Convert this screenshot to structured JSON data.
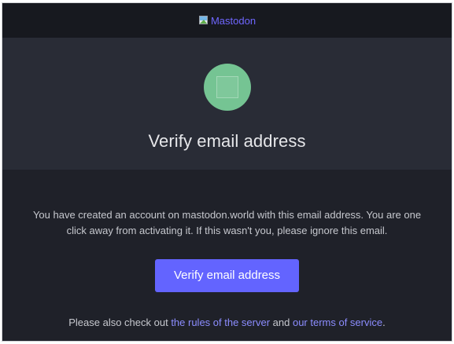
{
  "header": {
    "logo_alt": "Mastodon",
    "logo_icon": "broken-image-icon"
  },
  "hero": {
    "badge_icon": "broken-image-icon",
    "badge_color": "#75c493",
    "title": "Verify email address"
  },
  "content": {
    "message_line1": "You have created an account on mastodon.world with this email address. You are one",
    "message_line2": "click away from activating it. If this wasn't you, please ignore this email.",
    "cta_label": "Verify email address",
    "cta_color": "#6364ff",
    "footer_prefix": "Please also check out ",
    "rules_link": "the rules of the server",
    "footer_and": " and ",
    "terms_link": "our terms of service",
    "footer_suffix": "."
  },
  "colors": {
    "link": "#8c8dff",
    "header_bg": "#17191f",
    "hero_bg": "#292c36",
    "content_bg": "#1f2129"
  }
}
